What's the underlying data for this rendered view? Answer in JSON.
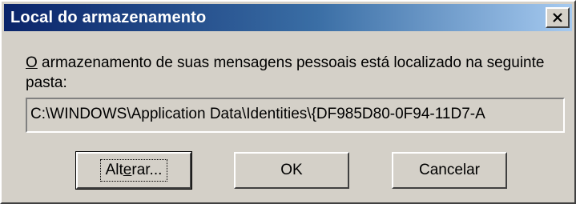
{
  "window": {
    "title": "Local do armazenamento"
  },
  "message": {
    "mnemonic": "O",
    "text_rest": " armazenamento de suas mensagens pessoais está localizado na seguinte pasta:"
  },
  "path": {
    "value": "C:\\WINDOWS\\Application Data\\Identities\\{DF985D80-0F94-11D7-A"
  },
  "buttons": {
    "change_pre": "Alt",
    "change_mnemonic": "e",
    "change_post": "rar...",
    "ok_label": "OK",
    "cancel_label": "Cancelar"
  },
  "icons": {
    "close": "close-icon"
  },
  "colors": {
    "titlebar_start": "#0a246a",
    "titlebar_end": "#a6caf0",
    "face": "#d4d0c8"
  }
}
